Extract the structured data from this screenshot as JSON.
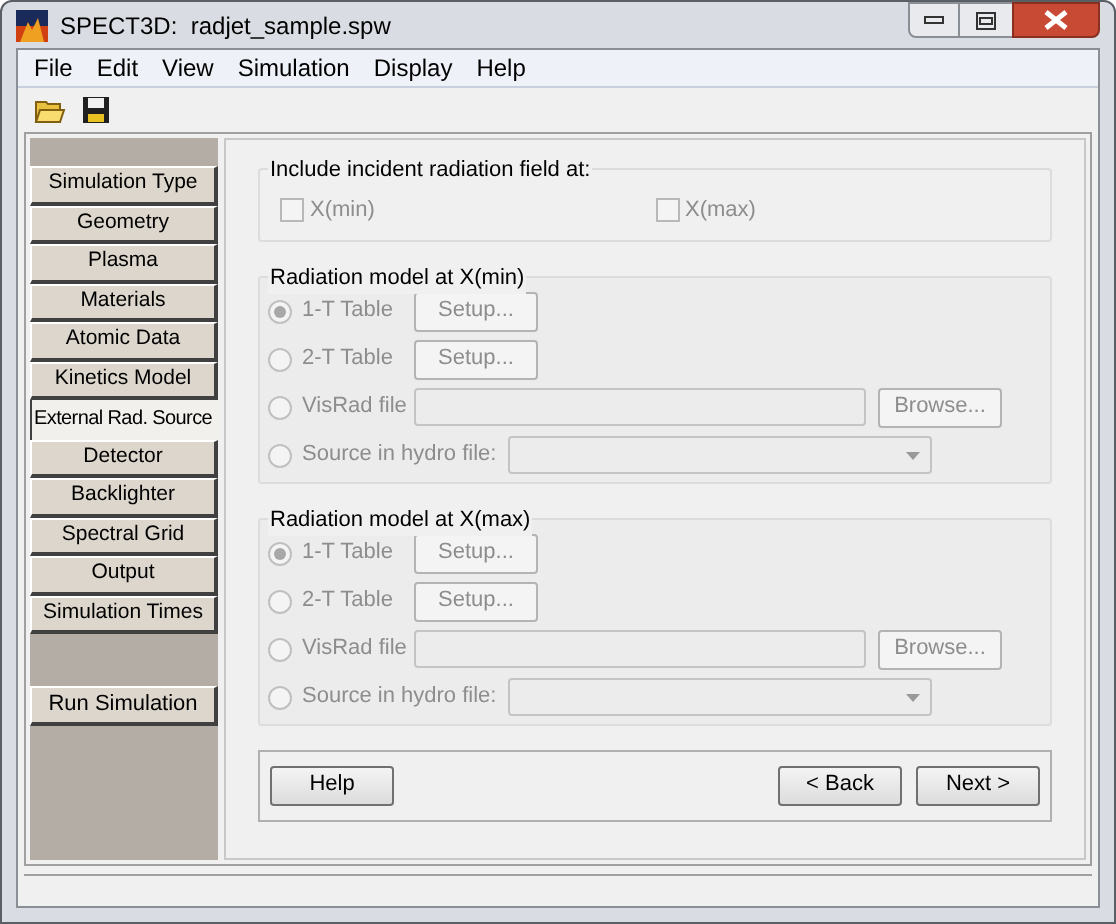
{
  "window": {
    "title": "SPECT3D:  radjet_sample.spw"
  },
  "menu": [
    {
      "label": "File"
    },
    {
      "label": "Edit"
    },
    {
      "label": "View"
    },
    {
      "label": "Simulation"
    },
    {
      "label": "Display"
    },
    {
      "label": "Help"
    }
  ],
  "sidebar": {
    "items": [
      {
        "label": "Simulation Type",
        "selected": false
      },
      {
        "label": "Geometry",
        "selected": false
      },
      {
        "label": "Plasma",
        "selected": false
      },
      {
        "label": "Materials",
        "selected": false
      },
      {
        "label": "Atomic Data",
        "selected": false
      },
      {
        "label": "Kinetics Model",
        "selected": false
      },
      {
        "label": "External Rad. Source",
        "selected": true
      },
      {
        "label": "Detector",
        "selected": false
      },
      {
        "label": "Backlighter",
        "selected": false
      },
      {
        "label": "Spectral Grid",
        "selected": false
      },
      {
        "label": "Output",
        "selected": false
      },
      {
        "label": "Simulation Times",
        "selected": false
      }
    ],
    "run_button": "Run Simulation"
  },
  "include": {
    "title": "Include incident radiation field at:",
    "checkboxes": [
      {
        "label": "X(min)",
        "checked": false,
        "disabled": true
      },
      {
        "label": "X(max)",
        "checked": false,
        "disabled": true
      }
    ]
  },
  "models": [
    {
      "title": "Radiation model at X(min)",
      "options": [
        {
          "kind": "button",
          "label": "1-T Table",
          "selected": true,
          "disabled": true,
          "button": "Setup..."
        },
        {
          "kind": "button",
          "label": "2-T Table",
          "selected": false,
          "disabled": true,
          "button": "Setup..."
        },
        {
          "kind": "file",
          "label": "VisRad file",
          "selected": false,
          "disabled": true,
          "button": "Browse..."
        },
        {
          "kind": "dropdown",
          "label": "Source in hydro file:",
          "selected": false,
          "disabled": true
        }
      ]
    },
    {
      "title": "Radiation model at X(max)",
      "options": [
        {
          "kind": "button",
          "label": "1-T Table",
          "selected": true,
          "disabled": true,
          "button": "Setup..."
        },
        {
          "kind": "button",
          "label": "2-T Table",
          "selected": false,
          "disabled": true,
          "button": "Setup..."
        },
        {
          "kind": "file",
          "label": "VisRad file",
          "selected": false,
          "disabled": true,
          "button": "Browse..."
        },
        {
          "kind": "dropdown",
          "label": "Source in hydro file:",
          "selected": false,
          "disabled": true
        }
      ]
    }
  ],
  "footer": {
    "help": "Help",
    "back": "< Back",
    "next": "Next >"
  }
}
